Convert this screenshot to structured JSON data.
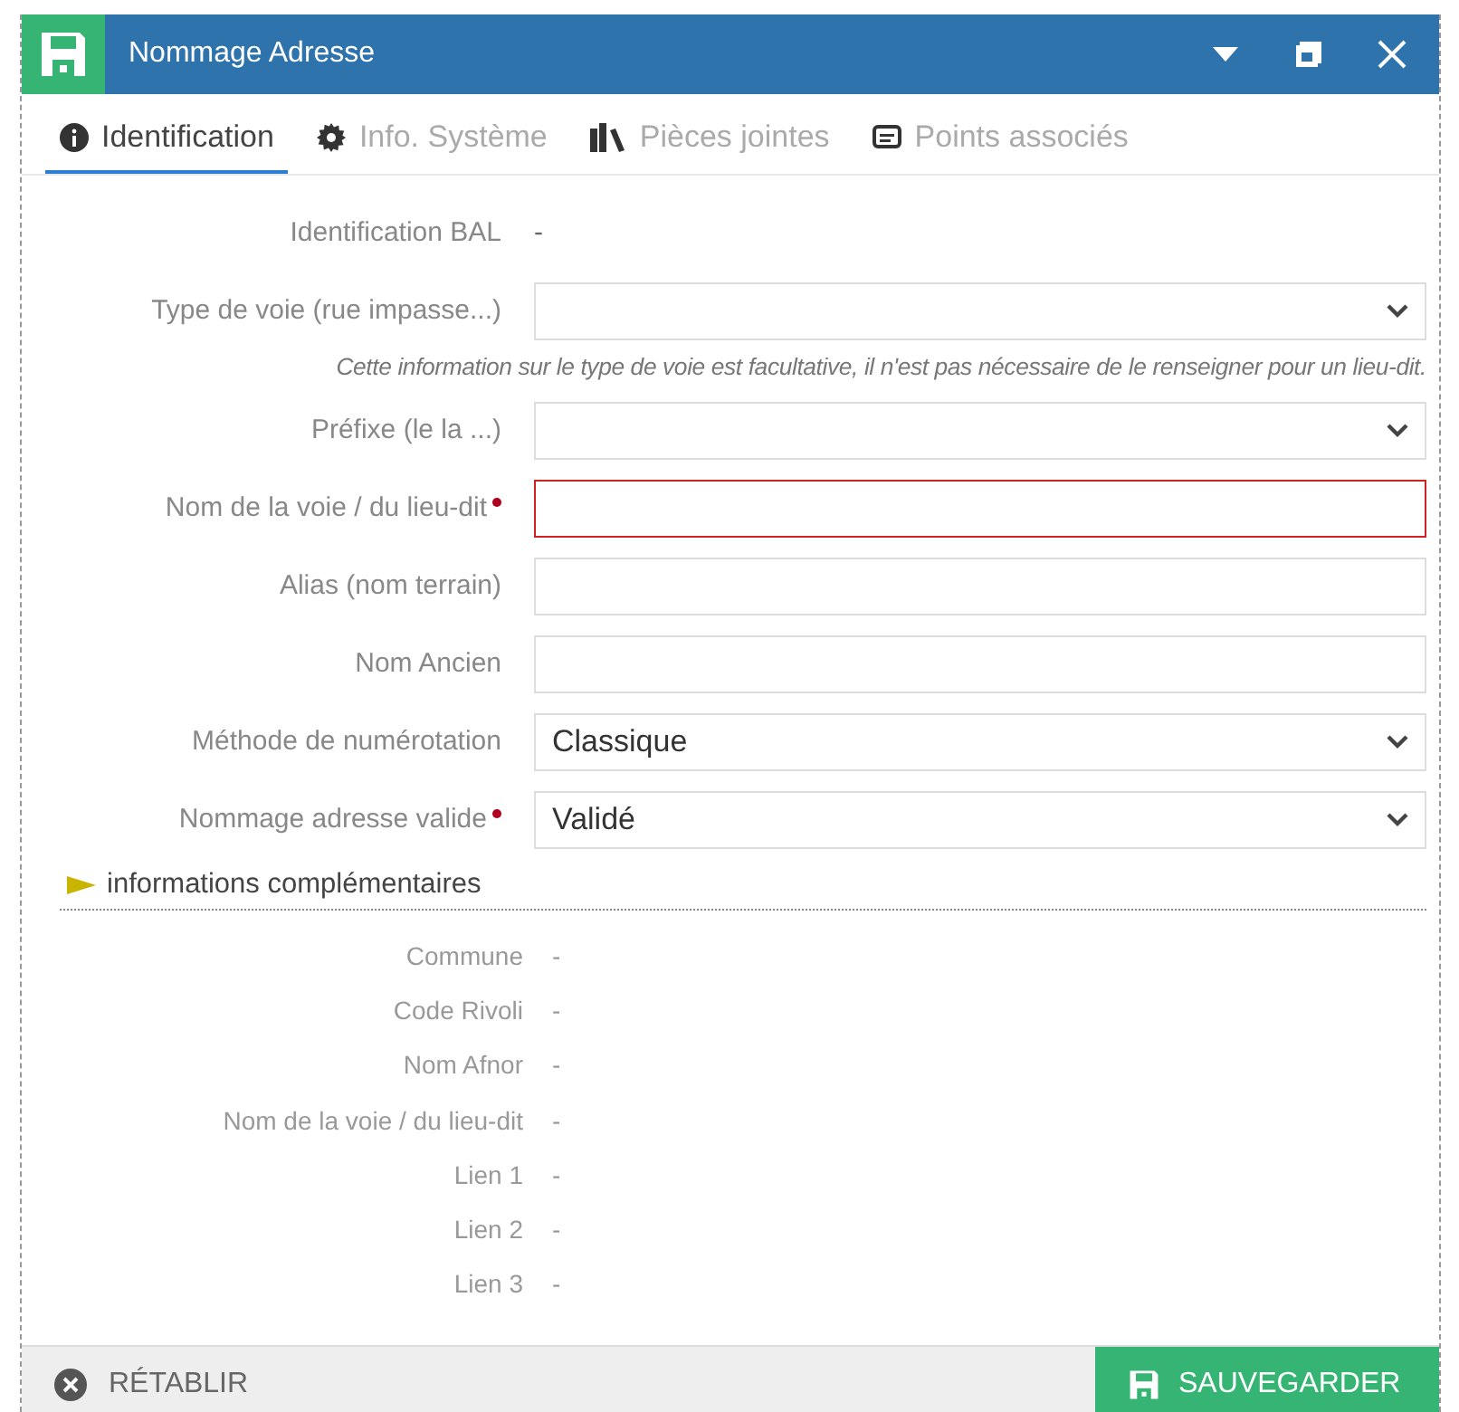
{
  "window": {
    "title": "Nommage Adresse"
  },
  "tabs": [
    {
      "label": "Identification",
      "selected": true
    },
    {
      "label": "Info. Système",
      "selected": false
    },
    {
      "label": "Pièces jointes",
      "selected": false
    },
    {
      "label": "Points associés",
      "selected": false
    }
  ],
  "form": [
    {
      "kind": "static",
      "label": "Identification BAL",
      "value": "-",
      "required": false
    },
    {
      "kind": "select",
      "label": "Type de voie (rue impasse...)",
      "required": false,
      "invalid": false
    },
    {
      "kind": "hint",
      "text": "Cette information sur le type de voie est facultative, il n'est pas nécessaire de le renseigner pour un lieu-dit."
    },
    {
      "kind": "select",
      "label": "Préfixe (le la ...)",
      "required": false,
      "invalid": false
    },
    {
      "kind": "input",
      "label": "Nom de la voie / du lieu-dit",
      "required": true,
      "invalid": true
    },
    {
      "kind": "input",
      "label": "Alias (nom terrain)",
      "required": false,
      "invalid": false
    },
    {
      "kind": "input",
      "label": "Nom Ancien",
      "required": false,
      "invalid": false
    },
    {
      "kind": "select",
      "label": "Méthode de numérotation",
      "value": "Classique",
      "required": false,
      "invalid": false
    },
    {
      "kind": "select",
      "label": "Nommage adresse valide",
      "value": "Validé",
      "required": true,
      "invalid": false
    }
  ],
  "extra": {
    "title": "informations complémentaires",
    "expanded": false,
    "rows": [
      {
        "label": "Commune",
        "value": "-"
      },
      {
        "label": "Code Rivoli",
        "value": "-"
      },
      {
        "label": "Nom Afnor",
        "value": "-"
      },
      {
        "label": "Nom de la voie / du lieu-dit",
        "value": "-"
      },
      {
        "label": "Lien 1",
        "value": "-"
      },
      {
        "label": "Lien 2",
        "value": "-"
      },
      {
        "label": "Lien 3",
        "value": "-"
      }
    ]
  },
  "footer": {
    "reset": "RÉTABLIR",
    "save": "SAUVEGARDER"
  }
}
